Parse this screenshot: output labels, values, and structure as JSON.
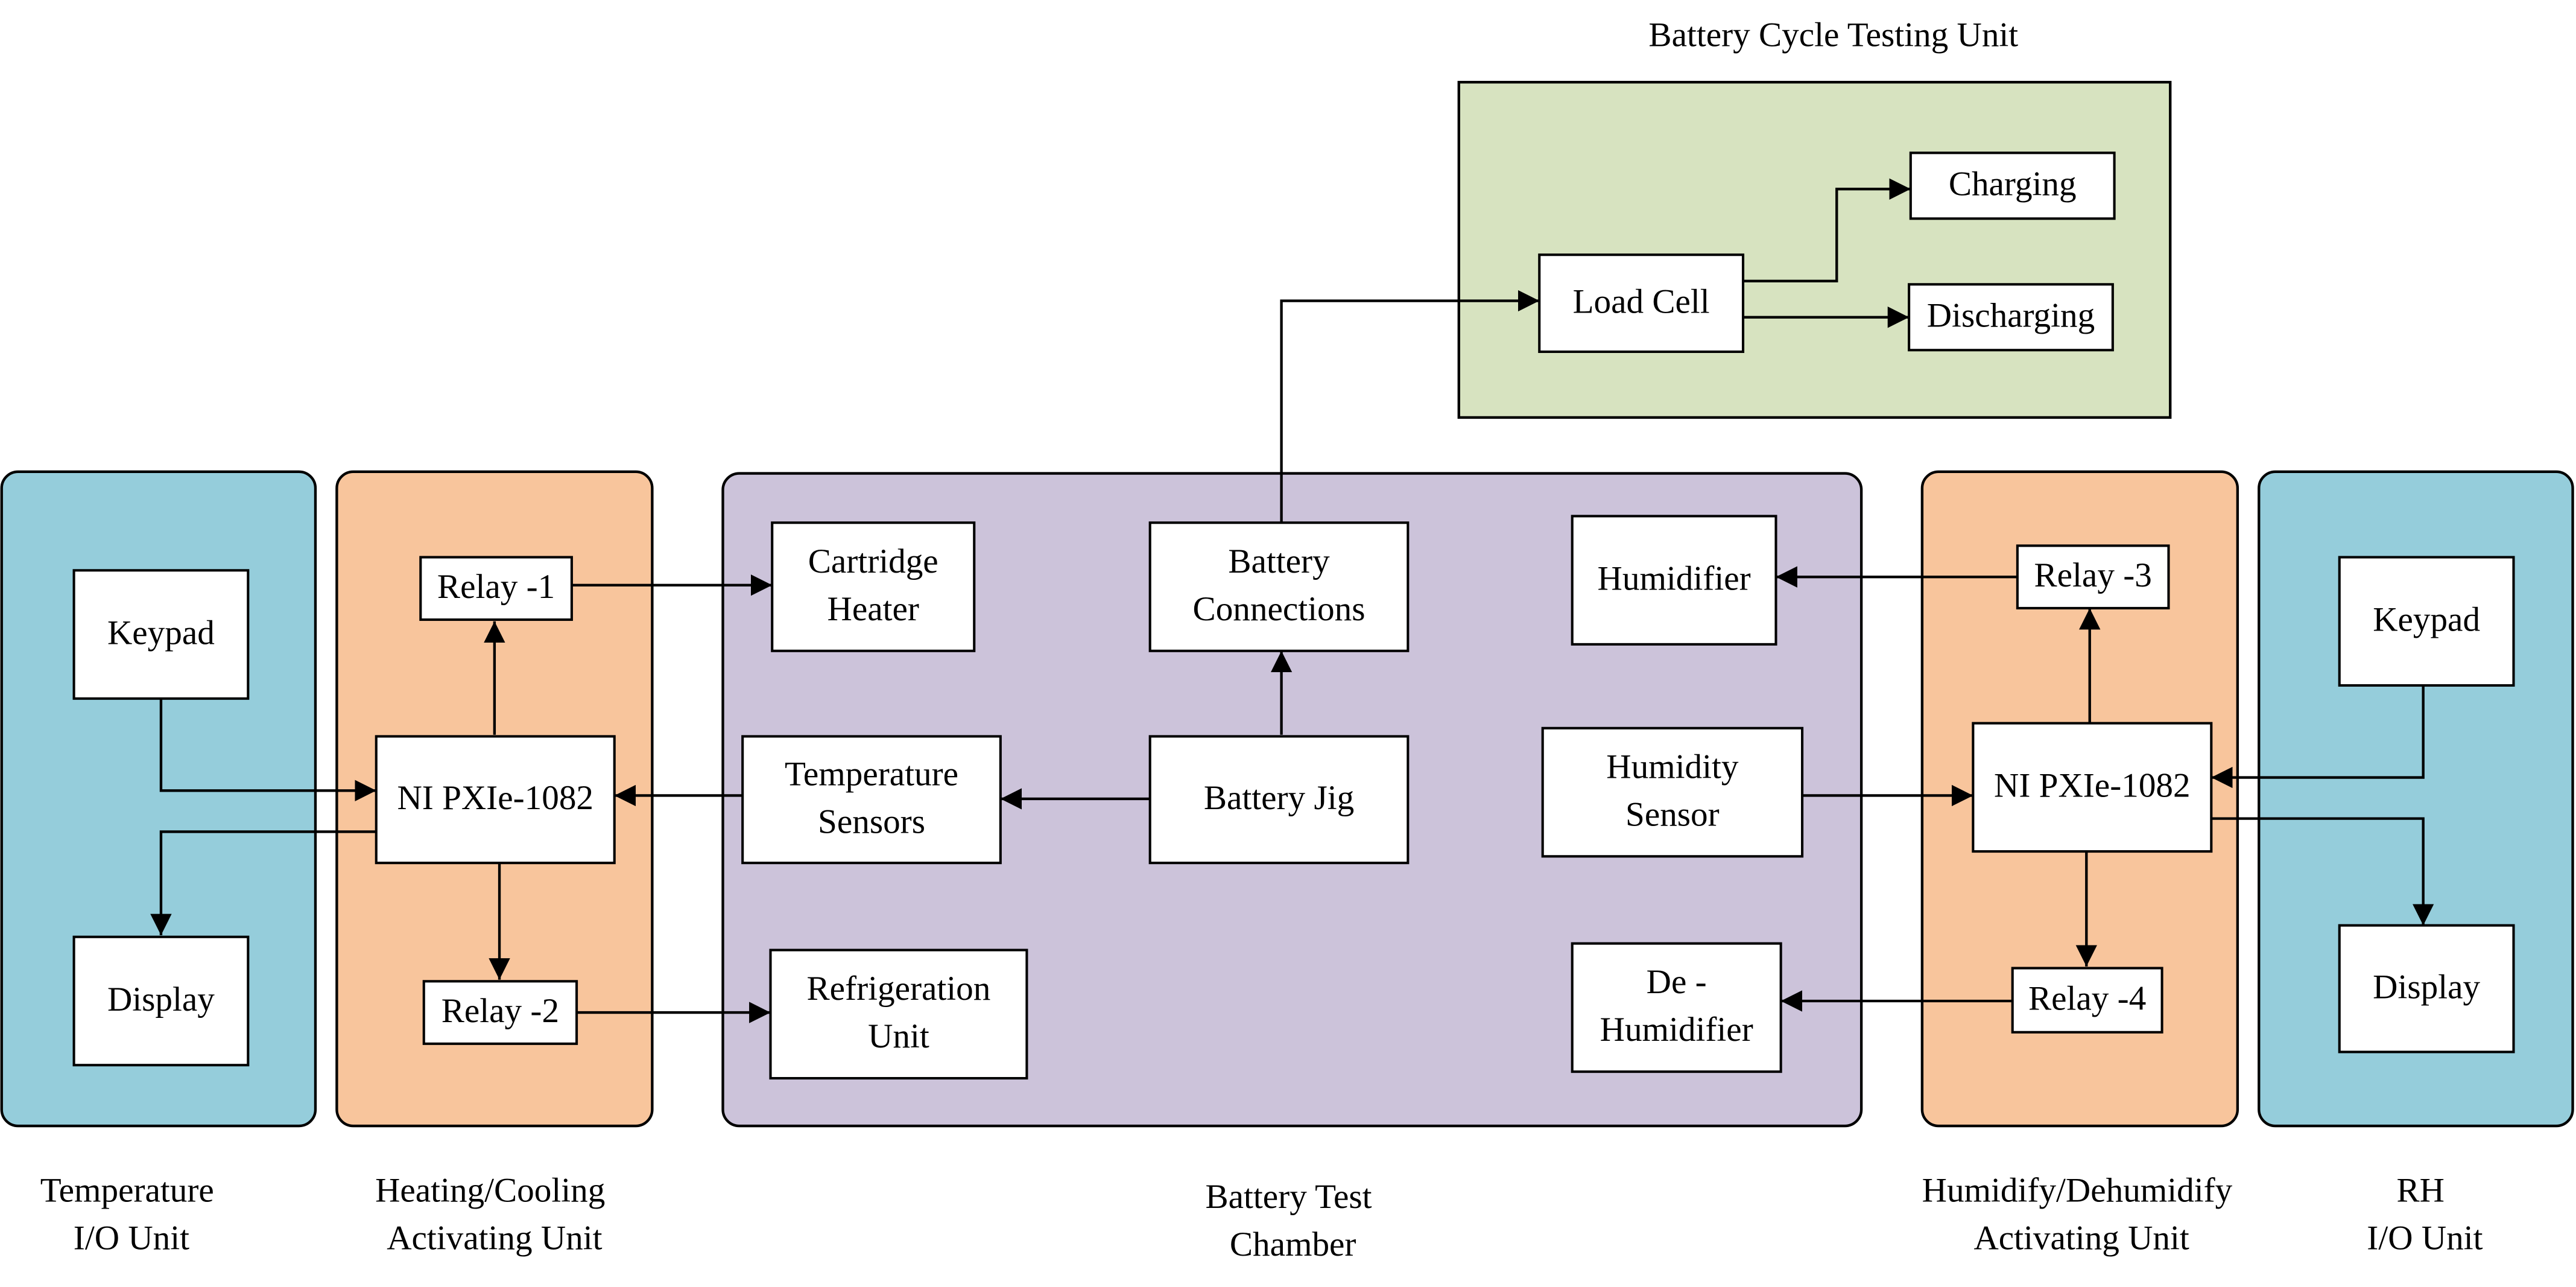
{
  "colors": {
    "io_unit": "#95CDDB",
    "activating_unit": "#F8C59C",
    "chamber": "#CCC3DA",
    "cycle_unit": "#D7E3C0",
    "box": "#FFFFFF",
    "stroke": "#000000"
  },
  "titles": {
    "cycle_unit": "Battery Cycle Testing Unit"
  },
  "captions": {
    "temp_io": [
      "Temperature",
      "I/O Unit"
    ],
    "heat_cool": [
      "Heating/Cooling",
      "Activating Unit"
    ],
    "chamber": [
      "Battery Test",
      "Chamber"
    ],
    "hum_dehum": [
      "Humidify/Dehumidify",
      "Activating Unit"
    ],
    "rh_io": [
      "RH",
      "I/O Unit"
    ]
  },
  "boxes": {
    "keypad_left": [
      "Keypad"
    ],
    "display_left": [
      "Display"
    ],
    "relay1": [
      "Relay -1"
    ],
    "ni_left": [
      "NI PXIe-1082"
    ],
    "relay2": [
      "Relay -2"
    ],
    "cartridge_heater": [
      "Cartridge",
      "Heater"
    ],
    "battery_connections": [
      "Battery",
      "Connections"
    ],
    "humidifier": [
      "Humidifier"
    ],
    "temperature_sensors": [
      "Temperature",
      "Sensors"
    ],
    "battery_jig": [
      "Battery Jig"
    ],
    "humidity_sensor": [
      "Humidity",
      "Sensor"
    ],
    "refrigeration_unit": [
      "Refrigeration",
      "Unit"
    ],
    "dehumidifier": [
      "De -",
      "Humidifier"
    ],
    "relay3": [
      "Relay -3"
    ],
    "ni_right": [
      "NI PXIe-1082"
    ],
    "relay4": [
      "Relay -4"
    ],
    "keypad_right": [
      "Keypad"
    ],
    "display_right": [
      "Display"
    ],
    "load_cell": [
      "Load Cell"
    ],
    "charging": [
      "Charging"
    ],
    "discharging": [
      "Discharging"
    ]
  },
  "connections": [
    {
      "from": "keypad_left",
      "to": "ni_left"
    },
    {
      "from": "ni_left",
      "to": "display_left"
    },
    {
      "from": "ni_left",
      "to": "relay1"
    },
    {
      "from": "ni_left",
      "to": "relay2"
    },
    {
      "from": "relay1",
      "to": "cartridge_heater"
    },
    {
      "from": "relay2",
      "to": "refrigeration_unit"
    },
    {
      "from": "temperature_sensors",
      "to": "ni_left"
    },
    {
      "from": "battery_jig",
      "to": "temperature_sensors"
    },
    {
      "from": "battery_jig",
      "to": "battery_connections"
    },
    {
      "from": "battery_connections",
      "to": "load_cell"
    },
    {
      "from": "load_cell",
      "to": "charging"
    },
    {
      "from": "load_cell",
      "to": "discharging"
    },
    {
      "from": "humidity_sensor",
      "to": "ni_right"
    },
    {
      "from": "ni_right",
      "to": "relay3"
    },
    {
      "from": "ni_right",
      "to": "relay4"
    },
    {
      "from": "relay3",
      "to": "humidifier"
    },
    {
      "from": "relay4",
      "to": "dehumidifier"
    },
    {
      "from": "keypad_right",
      "to": "ni_right"
    },
    {
      "from": "ni_right",
      "to": "display_right"
    }
  ]
}
